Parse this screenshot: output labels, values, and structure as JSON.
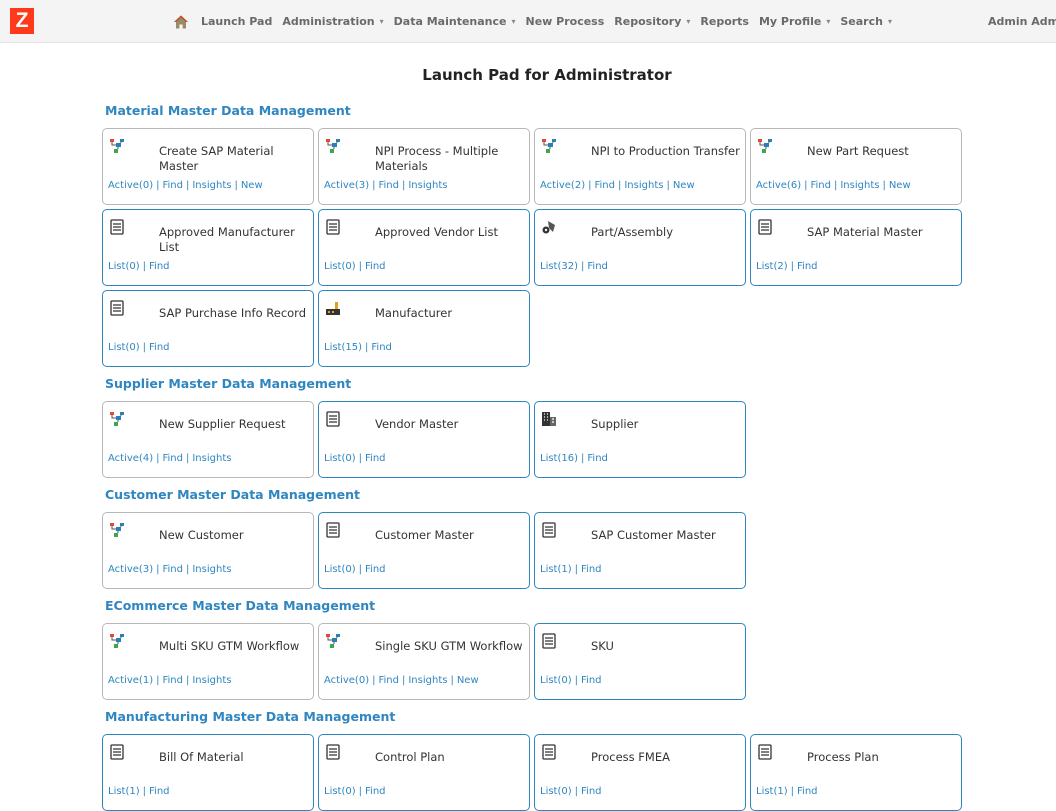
{
  "header": {
    "logo": "Z",
    "nav": [
      {
        "label": "Launch Pad",
        "dropdown": false
      },
      {
        "label": "Administration",
        "dropdown": true
      },
      {
        "label": "Data Maintenance",
        "dropdown": true
      },
      {
        "label": "New Process",
        "dropdown": false
      },
      {
        "label": "Repository",
        "dropdown": true
      },
      {
        "label": "Reports",
        "dropdown": false
      },
      {
        "label": "My Profile",
        "dropdown": true
      },
      {
        "label": "Search",
        "dropdown": true
      }
    ],
    "user": "Admin Adm"
  },
  "page_title": "Launch Pad for Administrator",
  "sections": [
    {
      "title": "Material Master Data Management",
      "tiles": [
        {
          "name": "Create SAP Material Master",
          "icon": "workflow-icon",
          "links": [
            "Active(0)",
            "Find",
            "Insights",
            "New"
          ]
        },
        {
          "name": "NPI Process - Multiple Materials",
          "icon": "workflow-icon",
          "links": [
            "Active(3)",
            "Find",
            "Insights"
          ]
        },
        {
          "name": "NPI to Production Transfer",
          "icon": "workflow-icon",
          "links": [
            "Active(2)",
            "Find",
            "Insights",
            "New"
          ]
        },
        {
          "name": "New Part Request",
          "icon": "workflow-icon",
          "links": [
            "Active(6)",
            "Find",
            "Insights",
            "New"
          ]
        },
        {
          "name": "Approved Manufacturer List",
          "icon": "record-icon",
          "links": [
            "List(0)",
            "Find"
          ]
        },
        {
          "name": "Approved Vendor List",
          "icon": "record-icon",
          "links": [
            "List(0)",
            "Find"
          ]
        },
        {
          "name": "Part/Assembly",
          "icon": "part-icon",
          "links": [
            "List(32)",
            "Find"
          ]
        },
        {
          "name": "SAP Material Master",
          "icon": "record-icon",
          "links": [
            "List(2)",
            "Find"
          ]
        },
        {
          "name": "SAP Purchase Info Record",
          "icon": "record-icon",
          "links": [
            "List(0)",
            "Find"
          ]
        },
        {
          "name": "Manufacturer",
          "icon": "factory-icon",
          "links": [
            "List(15)",
            "Find"
          ]
        }
      ]
    },
    {
      "title": "Supplier Master Data Management",
      "tiles": [
        {
          "name": "New Supplier Request",
          "icon": "workflow-icon",
          "links": [
            "Active(4)",
            "Find",
            "Insights"
          ]
        },
        {
          "name": "Vendor Master",
          "icon": "record-icon",
          "links": [
            "List(0)",
            "Find"
          ]
        },
        {
          "name": "Supplier",
          "icon": "building-icon",
          "links": [
            "List(16)",
            "Find"
          ]
        }
      ]
    },
    {
      "title": "Customer Master Data Management",
      "tiles": [
        {
          "name": "New Customer",
          "icon": "workflow-icon",
          "links": [
            "Active(3)",
            "Find",
            "Insights"
          ]
        },
        {
          "name": "Customer Master",
          "icon": "record-icon",
          "links": [
            "List(0)",
            "Find"
          ]
        },
        {
          "name": "SAP Customer Master",
          "icon": "record-icon",
          "links": [
            "List(1)",
            "Find"
          ]
        }
      ]
    },
    {
      "title": "ECommerce Master Data Management",
      "tiles": [
        {
          "name": "Multi SKU GTM Workflow",
          "icon": "workflow-icon",
          "links": [
            "Active(1)",
            "Find",
            "Insights"
          ]
        },
        {
          "name": "Single SKU GTM Workflow",
          "icon": "workflow-icon",
          "links": [
            "Active(0)",
            "Find",
            "Insights",
            "New"
          ]
        },
        {
          "name": "SKU",
          "icon": "record-icon",
          "links": [
            "List(0)",
            "Find"
          ]
        }
      ]
    },
    {
      "title": "Manufacturing Master Data Management",
      "tiles": [
        {
          "name": "Bill Of Material",
          "icon": "record-icon",
          "links": [
            "List(1)",
            "Find"
          ]
        },
        {
          "name": "Control Plan",
          "icon": "record-icon",
          "links": [
            "List(0)",
            "Find"
          ]
        },
        {
          "name": "Process FMEA",
          "icon": "record-icon",
          "links": [
            "List(0)",
            "Find"
          ]
        },
        {
          "name": "Process Plan",
          "icon": "record-icon",
          "links": [
            "List(1)",
            "Find"
          ]
        }
      ]
    }
  ]
}
